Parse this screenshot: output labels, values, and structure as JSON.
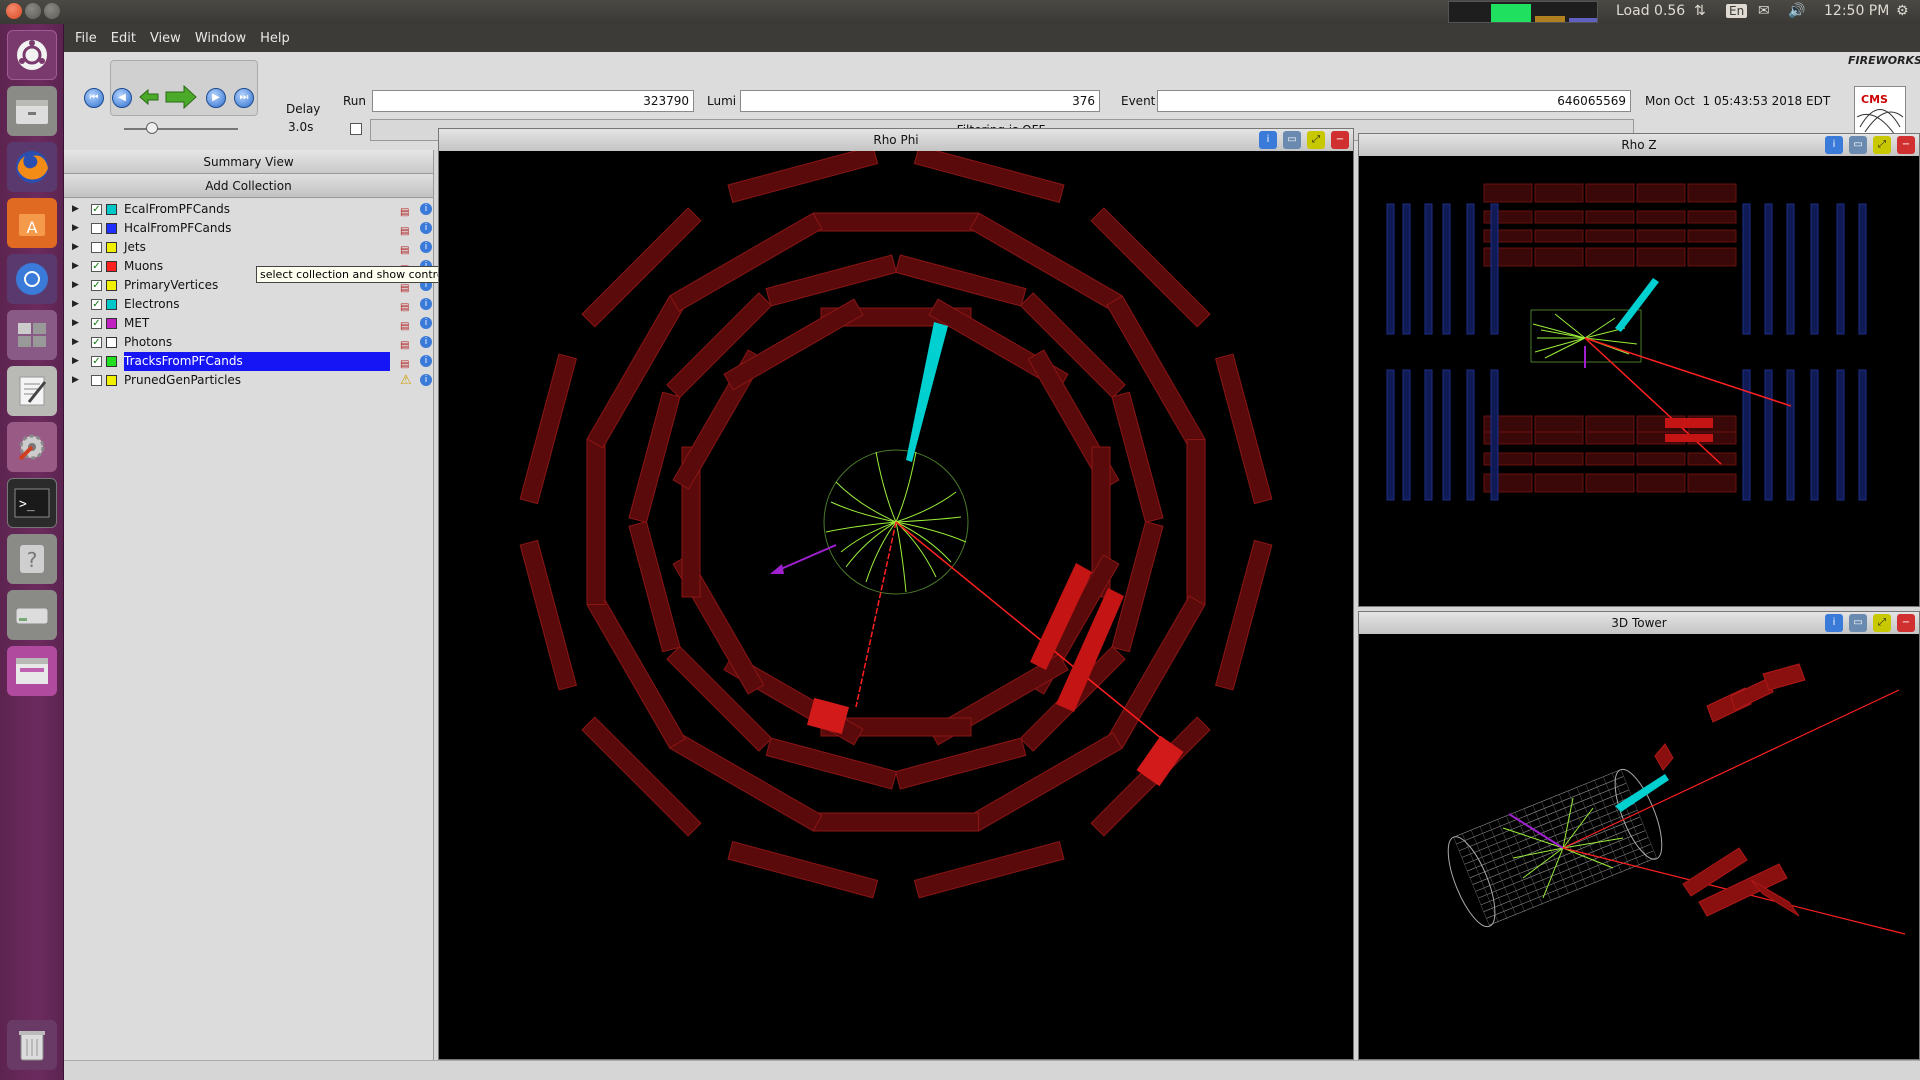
{
  "system": {
    "load": "Load 0.56",
    "language": "En",
    "clock": "12:50 PM"
  },
  "menu": {
    "items": [
      "File",
      "Edit",
      "View",
      "Window",
      "Help"
    ]
  },
  "toolbar": {
    "delay_label": "Delay",
    "delay_value": "3.0s",
    "run_label": "Run",
    "run_value": "323790",
    "lumi_label": "Lumi",
    "lumi_value": "376",
    "event_label": "Event",
    "event_value": "646065569",
    "filter_status": "Filtering is OFF.",
    "datetime": "Mon Oct  1 05:43:53 2018 EDT",
    "brand": "FIREWORKS",
    "logo_text": "CMS"
  },
  "summary": {
    "title": "Summary View",
    "add_collection": "Add Collection",
    "tooltip": "select collection and show controller",
    "collections": [
      {
        "name": "EcalFromPFCands",
        "checked": true,
        "color": "#00c8c8"
      },
      {
        "name": "HcalFromPFCands",
        "checked": false,
        "color": "#2030ff"
      },
      {
        "name": "Jets",
        "checked": false,
        "color": "#f0f000"
      },
      {
        "name": "Muons",
        "checked": true,
        "color": "#ff2020"
      },
      {
        "name": "PrimaryVertices",
        "checked": true,
        "color": "#f0f000"
      },
      {
        "name": "Electrons",
        "checked": true,
        "color": "#00c8c8"
      },
      {
        "name": "MET",
        "checked": true,
        "color": "#c020c0"
      },
      {
        "name": "Photons",
        "checked": true,
        "color": "#ffffff"
      },
      {
        "name": "TracksFromPFCands",
        "checked": true,
        "color": "#20e020"
      },
      {
        "name": "PrunedGenParticles",
        "checked": false,
        "color": "#f0f000"
      }
    ]
  },
  "views": {
    "rho_phi": "Rho Phi",
    "rho_z": "Rho Z",
    "tower_3d": "3D Tower"
  },
  "colors": {
    "detector": "#5a0a0a",
    "detector_edge": "#8a1616",
    "ecal": "#00d0d0",
    "track": "#9aee3a",
    "muon": "#ff2020",
    "met": "#a020d0",
    "selection": "#1515f5"
  }
}
